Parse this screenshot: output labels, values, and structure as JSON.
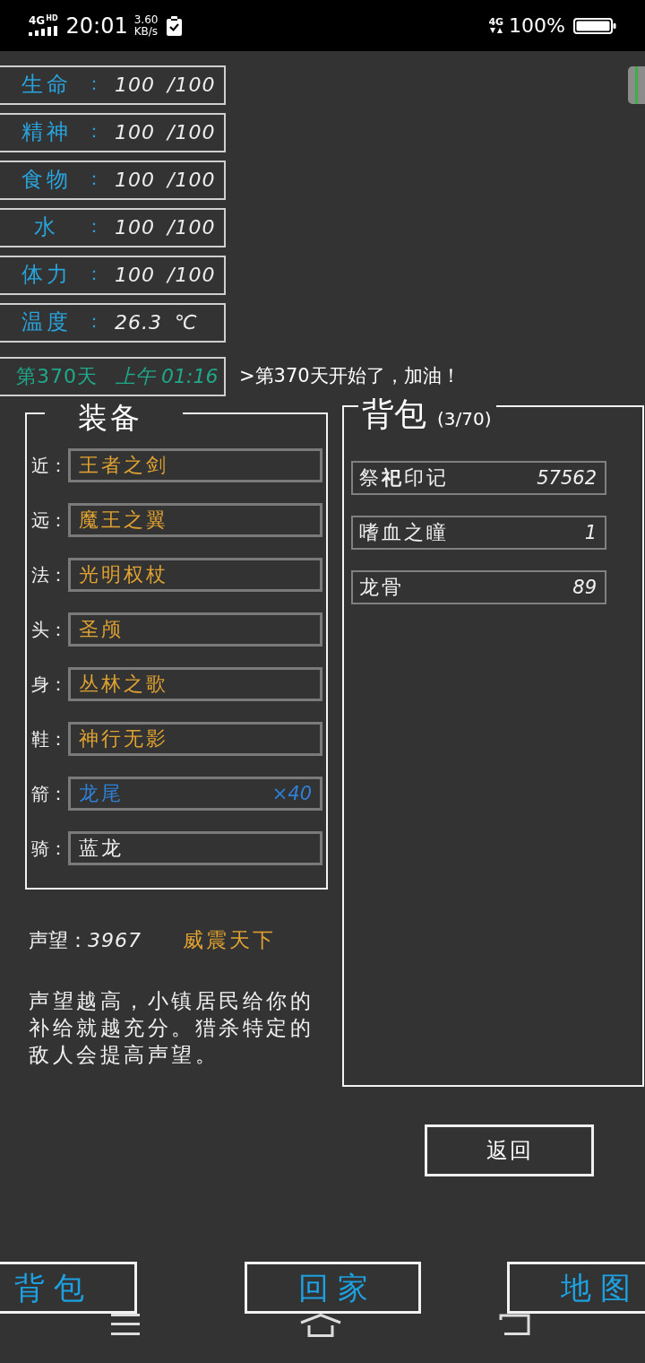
{
  "status_bar": {
    "network_type": "4G",
    "network_badge": "HD",
    "time": "20:01",
    "speed": "3.60",
    "speed_unit": "KB/s",
    "mobile_data": "4G",
    "battery": "100%"
  },
  "stats": [
    {
      "label": "生命",
      "separator": "：",
      "value": "100",
      "suffix": "/100"
    },
    {
      "label": "精神",
      "separator": "：",
      "value": "100",
      "suffix": "/100"
    },
    {
      "label": "食物",
      "separator": "：",
      "value": "100",
      "suffix": "/100"
    },
    {
      "label": "水",
      "separator": "：",
      "value": "100",
      "suffix": "/100"
    },
    {
      "label": "体力",
      "separator": "：",
      "value": "100",
      "suffix": "/100"
    },
    {
      "label": "温度",
      "separator": "：",
      "value": "26.3",
      "suffix": "℃"
    }
  ],
  "day": {
    "day": "第370天",
    "time": "上午 01:16"
  },
  "log_message": ">第370天开始了，加油！",
  "equipment": {
    "title": "装备",
    "slots": [
      {
        "label": "近：",
        "item": "王者之剑",
        "color": "#e0a231"
      },
      {
        "label": "远：",
        "item": "魔王之翼",
        "color": "#e0a231"
      },
      {
        "label": "法：",
        "item": "光明权杖",
        "color": "#e0a231"
      },
      {
        "label": "头：",
        "item": "圣颅",
        "color": "#e0a231"
      },
      {
        "label": "身：",
        "item": "丛林之歌",
        "color": "#e0a231"
      },
      {
        "label": "鞋：",
        "item": "神行无影",
        "color": "#e0a231"
      },
      {
        "label": "箭：",
        "item": "龙尾",
        "count": "×40",
        "color": "#2f80d8"
      },
      {
        "label": "骑：",
        "item": "蓝龙",
        "color": "#f0f0f0"
      }
    ]
  },
  "reputation": {
    "label": "声望：",
    "value": "3967",
    "title": "威震天下",
    "description": "声望越高，小镇居民给你的补给就越充分。猎杀特定的敌人会提高声望。"
  },
  "backpack": {
    "title": "背包",
    "capacity": "(3/70)",
    "items": [
      {
        "name": "祭**祀**印记",
        "count": "57562"
      },
      {
        "name": "嗜血之瞳",
        "count": "1"
      },
      {
        "name": "龙骨",
        "count": "89"
      }
    ]
  },
  "return_button": "返回",
  "bottom_nav": [
    {
      "label": "背包"
    },
    {
      "label": "回家"
    },
    {
      "label": "地图"
    }
  ]
}
